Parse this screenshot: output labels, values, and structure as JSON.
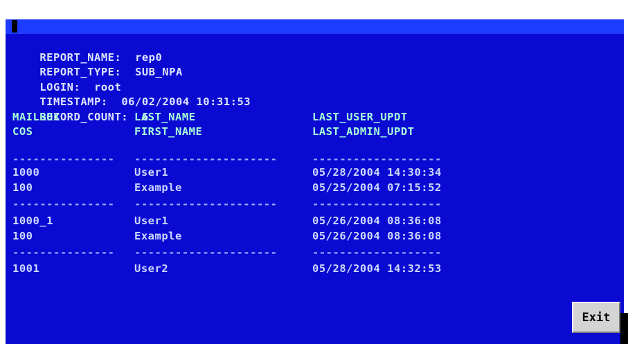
{
  "meta": {
    "report_name_label": "REPORT_NAME:",
    "report_name_value": "rep0",
    "report_type_label": "REPORT_TYPE:",
    "report_type_value": "SUB_NPA",
    "login_label": "LOGIN:",
    "login_value": "root",
    "timestamp_label": "TIMESTAMP:",
    "timestamp_value": "06/02/2004 10:31:53",
    "record_count_label": "RECORD_COUNT:",
    "record_count_value": "6"
  },
  "headers": {
    "row1": [
      "MAILBOX",
      "LAST_NAME",
      "LAST_USER_UPDT"
    ],
    "row2": [
      "COS",
      "FIRST_NAME",
      "LAST_ADMIN_UPDT"
    ]
  },
  "separator": [
    "---------------",
    "---------------------",
    "-------------------"
  ],
  "records": [
    {
      "line1": [
        "1000",
        "User1",
        "05/28/2004 14:30:34"
      ],
      "line2": [
        "100",
        "Example",
        "05/25/2004 07:15:52"
      ]
    },
    {
      "line1": [
        "1000_1",
        "User1",
        "05/26/2004 08:36:08"
      ],
      "line2": [
        "100",
        "Example",
        "05/26/2004 08:36:08"
      ]
    },
    {
      "line1": [
        "1001",
        "User2",
        "05/28/2004 14:32:53"
      ]
    }
  ],
  "exit_label": "Exit"
}
